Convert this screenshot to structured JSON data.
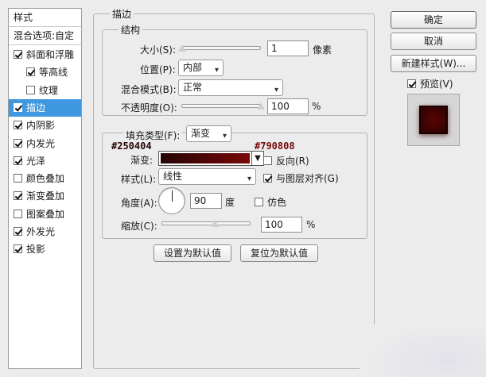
{
  "left_panel": {
    "header": "样式",
    "blend_options": "混合选项:自定",
    "items": [
      {
        "label": "斜面和浮雕",
        "checked": true,
        "sub": false,
        "selected": false
      },
      {
        "label": "等高线",
        "checked": true,
        "sub": true,
        "selected": false
      },
      {
        "label": "纹理",
        "checked": false,
        "sub": true,
        "selected": false
      },
      {
        "label": "描边",
        "checked": true,
        "sub": false,
        "selected": true
      },
      {
        "label": "内阴影",
        "checked": true,
        "sub": false,
        "selected": false
      },
      {
        "label": "内发光",
        "checked": true,
        "sub": false,
        "selected": false
      },
      {
        "label": "光泽",
        "checked": true,
        "sub": false,
        "selected": false
      },
      {
        "label": "颜色叠加",
        "checked": false,
        "sub": false,
        "selected": false
      },
      {
        "label": "渐变叠加",
        "checked": true,
        "sub": false,
        "selected": false
      },
      {
        "label": "图案叠加",
        "checked": false,
        "sub": false,
        "selected": false
      },
      {
        "label": "外发光",
        "checked": true,
        "sub": false,
        "selected": false
      },
      {
        "label": "投影",
        "checked": true,
        "sub": false,
        "selected": false
      }
    ]
  },
  "stroke": {
    "title": "描边",
    "structure_title": "结构",
    "size_label": "大小(S):",
    "size_value": "1",
    "size_unit": "像素",
    "position_label": "位置(P):",
    "position_value": "内部",
    "blend_label": "混合模式(B):",
    "blend_value": "正常",
    "opacity_label": "不透明度(O):",
    "opacity_value": "100",
    "opacity_unit": "%",
    "fill_type_label": "填充类型(F):",
    "fill_type_value": "渐变",
    "gradient_label": "渐变:",
    "color_start": "#250404",
    "color_end": "#790808",
    "reverse_label": "反向(R)",
    "reverse_checked": false,
    "style_label": "样式(L):",
    "style_value": "线性",
    "align_label": "与图层对齐(G)",
    "align_checked": true,
    "angle_label": "角度(A):",
    "angle_value": "90",
    "angle_unit": "度",
    "dither_label": "仿色",
    "dither_checked": false,
    "scale_label": "缩放(C):",
    "scale_value": "100",
    "scale_unit": "%",
    "make_default": "设置为默认值",
    "reset_default": "复位为默认值"
  },
  "right_panel": {
    "ok": "确定",
    "cancel": "取消",
    "new_style": "新建样式(W)...",
    "preview_label": "预览(V)",
    "preview_checked": true
  },
  "colors": {
    "selected": "#3f98e0",
    "swatch_dark": "#3a0202",
    "swatch_border": "#1a0000"
  }
}
